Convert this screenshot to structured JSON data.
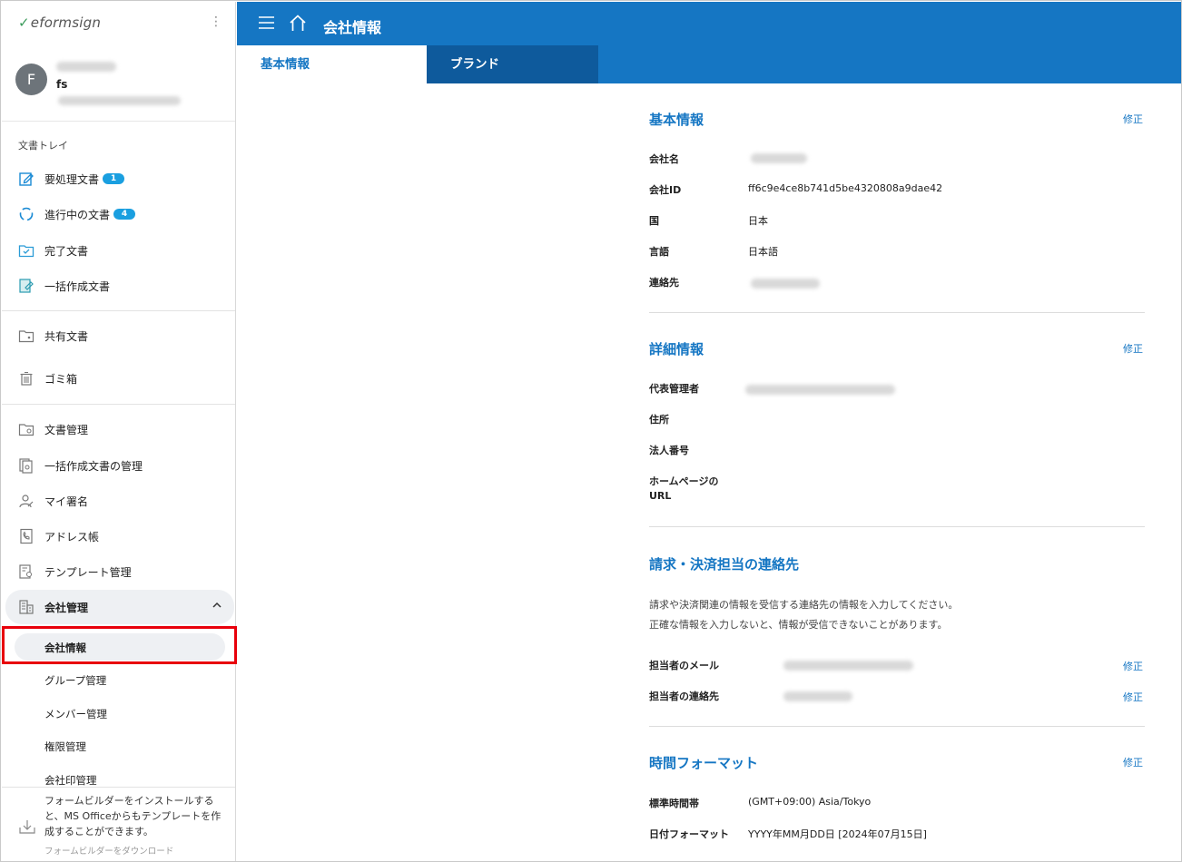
{
  "app": {
    "logo": "eformsign"
  },
  "profile": {
    "initial": "F",
    "short": "fs"
  },
  "sidebar": {
    "section_title": "文書トレイ",
    "items": [
      {
        "label": "要処理文書",
        "badge": "1"
      },
      {
        "label": "進行中の文書",
        "badge": "4"
      },
      {
        "label": "完了文書"
      },
      {
        "label": "一括作成文書"
      },
      {
        "label": "共有文書"
      },
      {
        "label": "ゴミ箱"
      },
      {
        "label": "文書管理"
      },
      {
        "label": "一括作成文書の管理"
      },
      {
        "label": "マイ署名"
      },
      {
        "label": "アドレス帳"
      },
      {
        "label": "テンプレート管理"
      },
      {
        "label": "会社管理"
      }
    ],
    "sub_items": [
      "会社情報",
      "グループ管理",
      "メンバー管理",
      "権限管理",
      "会社印管理"
    ],
    "footer_text": "フォームビルダーをインストールすると、MS Officeからもテンプレートを作成することができます。",
    "footer_link": "フォームビルダーをダウンロード"
  },
  "header": {
    "title": "会社情報",
    "tabs": [
      "基本情報",
      "ブランド"
    ]
  },
  "basic": {
    "title": "基本情報",
    "edit": "修正",
    "company_name_label": "会社名",
    "company_id_label": "会社ID",
    "company_id": "ff6c9e4ce8b741d5be4320808a9dae42",
    "country_label": "国",
    "country": "日本",
    "language_label": "言語",
    "language": "日本語",
    "contact_label": "連絡先"
  },
  "detail": {
    "title": "詳細情報",
    "edit": "修正",
    "admin_label": "代表管理者",
    "address_label": "住所",
    "corp_number_label": "法人番号",
    "homepage_label_1": "ホームページの",
    "homepage_label_2": "URL"
  },
  "billing": {
    "title": "請求・決済担当の連絡先",
    "desc_1": "請求や決済関連の情報を受信する連絡先の情報を入力してください。",
    "desc_2": "正確な情報を入力しないと、情報が受信できないことがあります。",
    "email_label": "担当者のメール",
    "phone_label": "担当者の連絡先",
    "edit": "修正"
  },
  "time": {
    "title": "時間フォーマット",
    "edit": "修正",
    "tz_label": "標準時間帯",
    "tz": "(GMT+09:00) Asia/Tokyo",
    "date_label": "日付フォーマット",
    "date": "YYYY年MM月DD日 [2024年07月15日]"
  }
}
